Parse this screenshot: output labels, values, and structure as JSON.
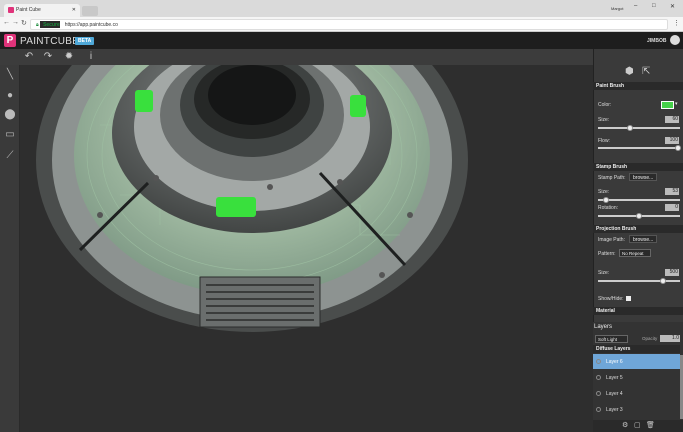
{
  "browser": {
    "tab_title": "Paint Cube",
    "window_user": "Margot",
    "secure_label": "Secure",
    "url": "https://app.paintcube.co"
  },
  "app": {
    "brand": "PAINTCUBE",
    "badge": "BETA",
    "user": "JIMBOB",
    "logo_letter": "P"
  },
  "toolbar": {
    "icons": [
      "undo-icon",
      "redo-icon",
      "texture-icon",
      "info-icon"
    ]
  },
  "tools": [
    "brush-icon",
    "circle-icon",
    "fill-icon",
    "eraser-icon",
    "eyedropper-icon"
  ],
  "panel": {
    "paint_brush": {
      "title": "Paint Brush",
      "color_label": "Color:",
      "color": "#46d14a",
      "size_label": "Size:",
      "size": "60",
      "flow_label": "Flow:",
      "flow": "100"
    },
    "stamp_brush": {
      "title": "Stamp Brush",
      "path_label": "Stamp Path:",
      "browse": "browse...",
      "size_label": "Size:",
      "size": "53",
      "rotation_label": "Rotation:",
      "rotation": "0"
    },
    "projection_brush": {
      "title": "Projection Brush",
      "path_label": "Image Path:",
      "browse": "browse...",
      "pattern_label": "Pattern:",
      "pattern": "No Repeat",
      "size_label": "Size:",
      "size": "500",
      "showhide_label": "Show/Hide:"
    },
    "material": {
      "title": "Material"
    }
  },
  "layers": {
    "title": "Layers",
    "mode": "Soft Light",
    "opacity_label": "Opacity",
    "opacity": "1.0",
    "group": "Diffuse Layers",
    "items": [
      "Layer 6",
      "Layer 5",
      "Layer 4",
      "Layer 3"
    ]
  },
  "colors": {
    "accent": "#e0337a",
    "beta": "#4fa8d8",
    "selected_layer": "#6fa6d8"
  }
}
